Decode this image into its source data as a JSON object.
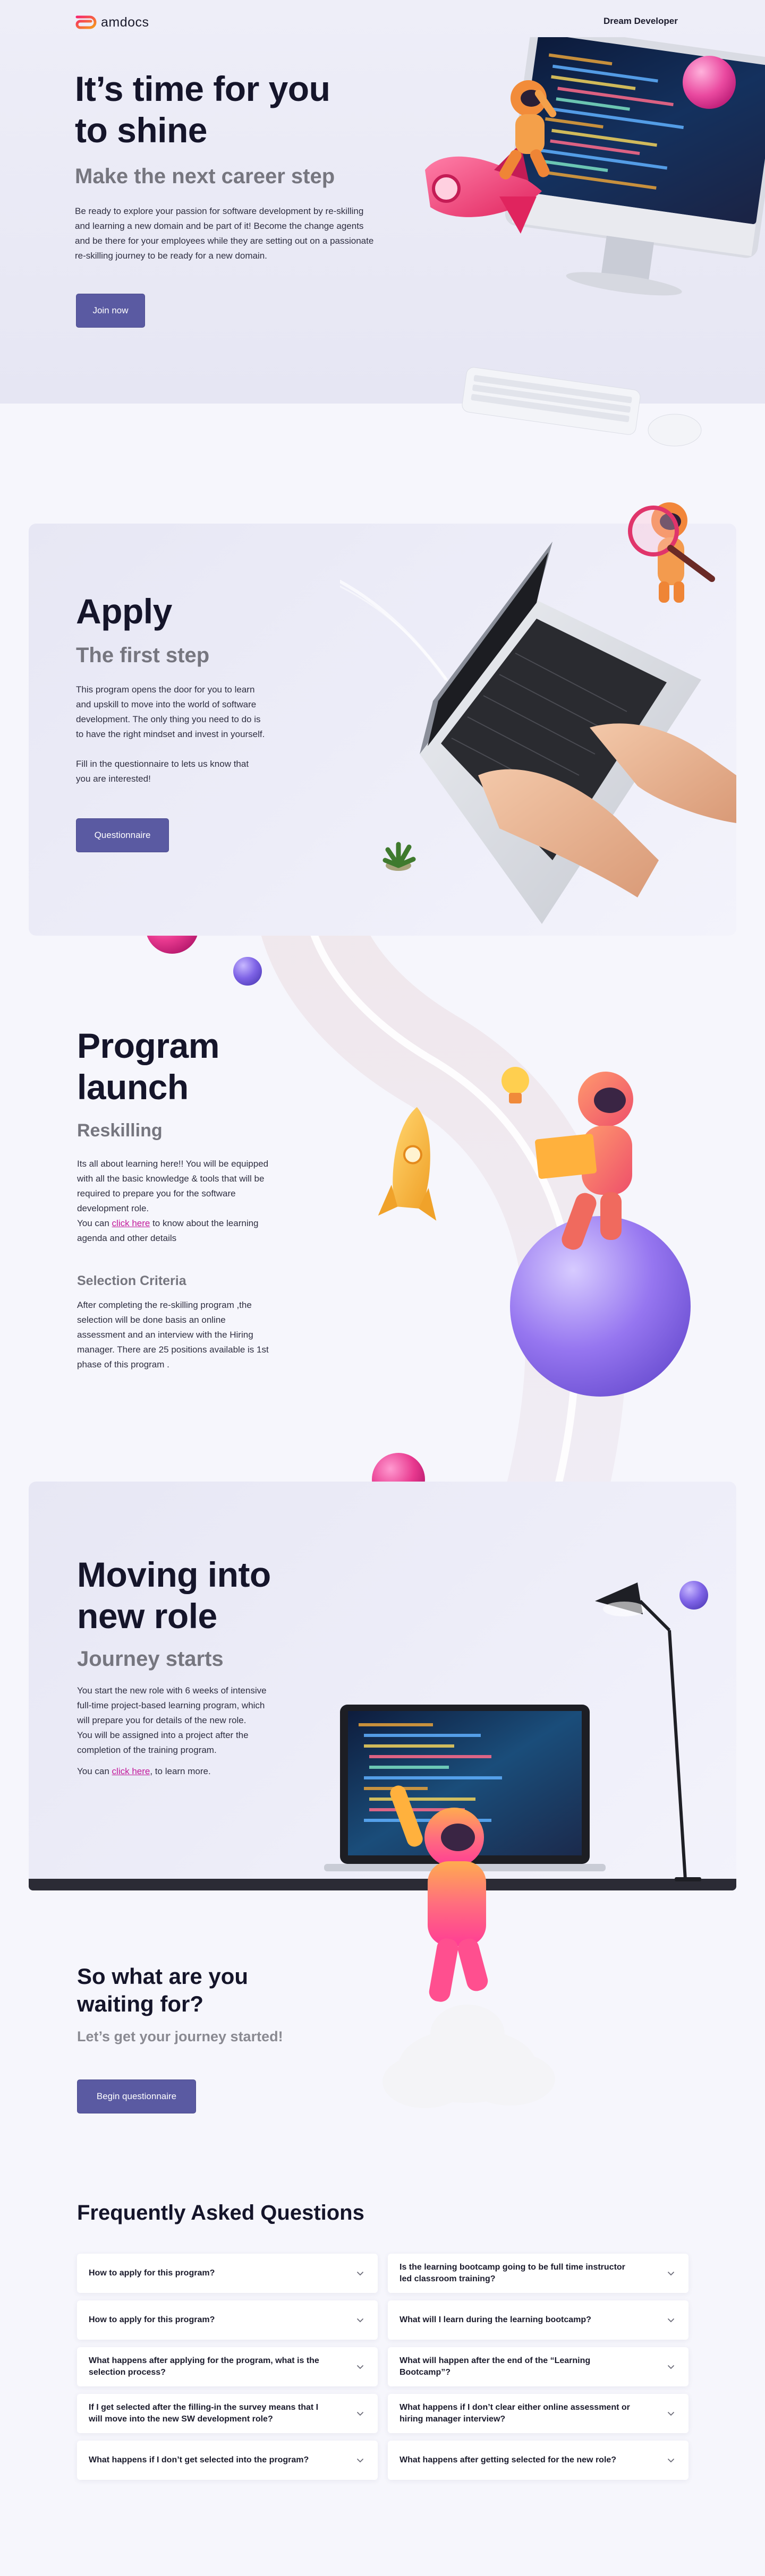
{
  "header": {
    "logo_text": "amdocs",
    "nav_right": "Dream Developer"
  },
  "hero": {
    "title_line1": "It’s time for you",
    "title_line2": "to shine",
    "subtitle": "Make the next career step",
    "body_lines": [
      "Be ready to explore your passion for software development by re-skilling",
      "and learning a new domain and be part of it! Become the change agents",
      "and be there for your employees while they are setting out on a passionate",
      "re-skilling journey to be ready for a new domain."
    ],
    "button_label": "Join now"
  },
  "apply": {
    "title": "Apply",
    "subtitle": "The first step",
    "body_lines": [
      "This program opens the door for you to learn",
      "and upskill to move into the world of software",
      "development.  The only thing you need to do is",
      "to have the right mindset and invest in yourself."
    ],
    "body2_lines": [
      "Fill in the questionnaire to lets us know that",
      "you are interested!"
    ],
    "button_label": "Questionnaire"
  },
  "launch": {
    "title_line1": "Program",
    "title_line2": "launch",
    "subtitle": "Reskilling",
    "body_lines": [
      "Its all about learning here!! You will be equipped",
      "with all the basic knowledge & tools that will be",
      "required to prepare you for the software",
      "development role."
    ],
    "link_prefix": "You can ",
    "link_text": "click here",
    "link_suffix": " to know about the learning",
    "link_line2": "agenda and other details",
    "criteria_title": "Selection Criteria",
    "criteria_lines": [
      "After completing the re-skilling program ,the",
      "selection will be done basis an online",
      "assessment and an interview with the Hiring",
      "manager. There are 25 positions available is 1st",
      "phase of this program ."
    ]
  },
  "role": {
    "title_line1": "Moving into",
    "title_line2": "new role",
    "subtitle": "Journey starts",
    "body_lines": [
      "You start the new role with 6 weeks of intensive",
      "full-time project-based learning program, which",
      "will prepare you for details of the new role.",
      "You will be assigned into a project after the",
      "completion of the training program."
    ],
    "link_prefix": "You can ",
    "link_text": "click here",
    "link_suffix": ", to learn more."
  },
  "cta": {
    "title_line1": "So what are you",
    "title_line2": "waiting for?",
    "subtitle": "Let’s get your journey started!",
    "button_label": "Begin questionnaire"
  },
  "faq": {
    "title": "Frequently Asked Questions",
    "left": [
      [
        "How to apply for this program?"
      ],
      [
        "How to apply for this program?"
      ],
      [
        "What happens after applying for the program, what is the",
        "selection process?"
      ],
      [
        "If I get selected after the filling-in the survey means that I",
        "will move into the new SW development role?"
      ],
      [
        "What happens if I don’t get selected into the program?"
      ]
    ],
    "right": [
      [
        "Is the learning bootcamp going to be full time instructor",
        "led classroom training?"
      ],
      [
        "What will I learn during the learning bootcamp?"
      ],
      [
        "What will happen after the end of the “Learning",
        "Bootcamp”?"
      ],
      [
        "What happens if I don’t clear either online assessment or",
        "hiring manager interview?"
      ],
      [
        "What happens after getting selected for the new role?"
      ]
    ]
  },
  "colors": {
    "accent_button": "#5a5aa2",
    "link": "#c2189a",
    "logo_gradient_start": "#f7256b",
    "logo_gradient_end": "#f59b1a"
  }
}
